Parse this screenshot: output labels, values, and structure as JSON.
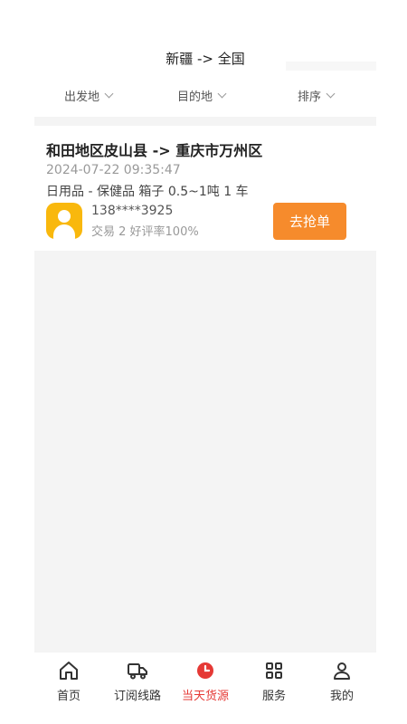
{
  "header": {
    "title": "新疆 -> 全国"
  },
  "filters": [
    {
      "label": "出发地"
    },
    {
      "label": "目的地"
    },
    {
      "label": "排序"
    }
  ],
  "listing": {
    "route": "和田地区皮山县 -> 重庆市万州区",
    "time": "2024-07-22 09:35:47",
    "goods": "日用品 - 保健品 箱子 0.5~1吨 1 车",
    "phone": "138****3925",
    "stats": "交易 2 好评率100%",
    "action_label": "去抢单"
  },
  "tabbar": {
    "items": [
      {
        "label": "首页",
        "icon": "home-icon"
      },
      {
        "label": "订阅线路",
        "icon": "truck-icon"
      },
      {
        "label": "当天货源",
        "icon": "clock-icon",
        "active": true
      },
      {
        "label": "服务",
        "icon": "grid-icon"
      },
      {
        "label": "我的",
        "icon": "user-icon"
      }
    ]
  },
  "colors": {
    "accent": "#f68b2c",
    "active_tab": "#e53935",
    "avatar": "#f9b80d",
    "background_gray": "#f4f4f4"
  }
}
